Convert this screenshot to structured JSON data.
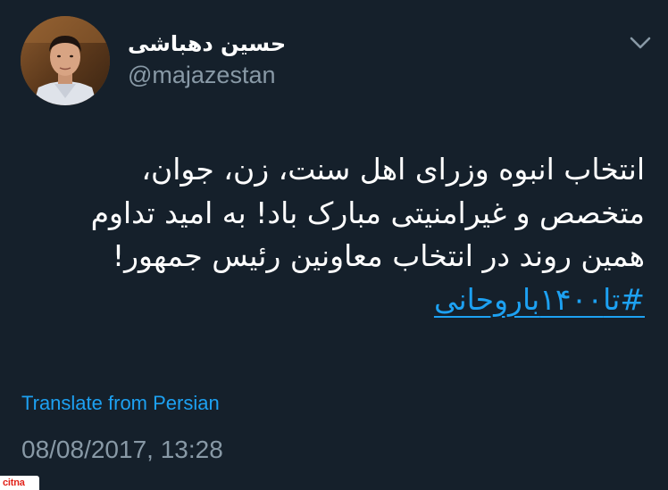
{
  "tweet": {
    "display_name": "حسین دهباشی",
    "handle": "@majazestan",
    "text_lines": [
      "انتخاب انبوه وزرای اهل سنت، زن، جوان،",
      "متخصص و غیرامنیتی مبارک باد! به امید تداوم",
      "همین روند در انتخاب معاونین رئیس جمهور!"
    ],
    "hashtag": "#تا۱۴۰۰باروحانی",
    "translate_label": "Translate from Persian",
    "timestamp": "08/08/2017, 13:28",
    "more_menu_icon": "chevron-down-icon"
  },
  "watermark": {
    "text": "citna"
  },
  "colors": {
    "background": "#15202b",
    "text": "#ffffff",
    "secondary_text": "#8899a6",
    "link": "#1da1f2",
    "watermark": "#e2231a"
  }
}
